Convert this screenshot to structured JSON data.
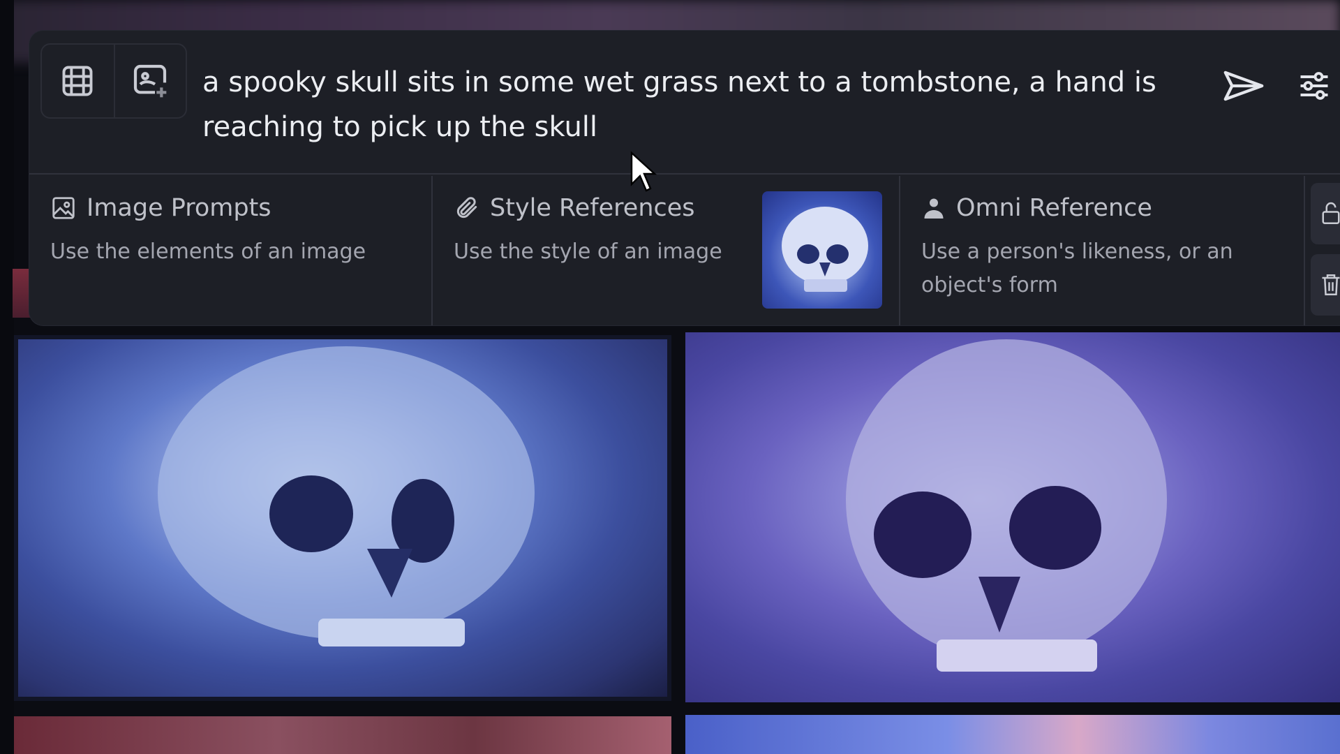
{
  "prompt": {
    "text": "a spooky skull sits in some wet grass next to a tombstone, a hand is reaching to pick up the skull"
  },
  "toolbar": {
    "icons": [
      "video-frame-icon",
      "image-add-icon",
      "send-icon",
      "settings-sliders-icon"
    ]
  },
  "references": [
    {
      "title": "Image Prompts",
      "description": "Use the elements of an image",
      "icon": "image-icon"
    },
    {
      "title": "Style References",
      "description": "Use the style of an image",
      "icon": "paperclip-icon"
    },
    {
      "title": "Omni Reference",
      "description": "Use a person's likeness, or an object's form",
      "icon": "person-icon"
    }
  ],
  "side_actions": [
    "unlock-icon",
    "trash-icon"
  ],
  "colors": {
    "panel_bg": "#1d1f26",
    "divider": "#30323c",
    "text_primary": "#eceef2",
    "text_muted": "#a4a6b0"
  }
}
